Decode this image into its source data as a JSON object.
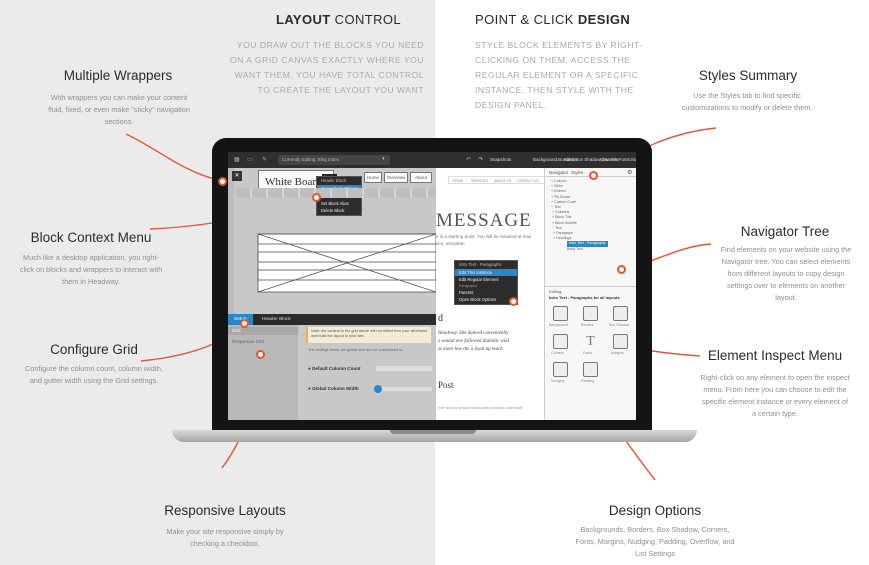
{
  "header_left": {
    "bold": "LAYOUT",
    "rest": " CONTROL",
    "body": "YOU DRAW OUT THE BLOCKS YOU NEED ON A GRID CANVAS EXACTLY WHERE YOU WANT THEM. YOU HAVE TOTAL CONTROL TO CREATE THE LAYOUT YOU WANT"
  },
  "header_right": {
    "rest": "POINT & CLICK ",
    "bold": "DESIGN",
    "body": "STYLE BLOCK ELEMENTS BY RIGHT-CLICKING ON THEM. ACCESS THE REGULAR ELEMENT OR A SPECIFIC INSTANCE. THEN STYLE WITH THE DESIGN PANEL."
  },
  "features": {
    "wrappers": {
      "title": "Multiple Wrappers",
      "desc": "With wrappers you can make your content fluid, fixed, or even make \"sticky\" navigation sections."
    },
    "context": {
      "title": "Block Context Menu",
      "desc": "Much like a desktop application, you right-click on blocks and wrappers to interact with them in Headway."
    },
    "grid": {
      "title": "Configure Grid",
      "desc": "Configure the column count, column width, and gutter width using the Grid settings."
    },
    "responsive": {
      "title": "Responsive Layouts",
      "desc": "Make your site responsive simply by checking a checkbox."
    },
    "styles": {
      "title": "Styles Summary",
      "desc": "Use the Styles tab to find specific customizations to modify or delete them."
    },
    "navigator": {
      "title": "Navigator Tree",
      "desc": "Find elements on your website using the Navigator tree. You can select elements from different layouts to copy design settings over to elements on another layout."
    },
    "inspect": {
      "title": "Element Inspect Menu",
      "desc": "Right-click on any element to open the inspect menu. From here you can choose to edit the specific element instance or every element of a certain type."
    },
    "design": {
      "title": "Design Options",
      "desc": "Backgrounds, Borders, Box Shadow, Corners, Fonts, Margins, Nudging, Padding, Overflow, and List Settings"
    }
  },
  "app": {
    "editing": "Currently Editing: Blog Index",
    "snapshots": "Snapshots",
    "tools": [
      "Background",
      "Borders",
      "Box Shadow",
      "Corners",
      "Fonts",
      "Margins",
      "Nudging",
      "Padding"
    ],
    "admin": "Admin",
    "view_site": "View Site",
    "logo": "White Board",
    "header_tag": "Header",
    "nav": [
      "Home",
      "Overview",
      "About"
    ],
    "block_menu": [
      "Header Block",
      "Open Block Options",
      "Switch Block Type",
      "Set Block Alias",
      "Delete Block"
    ],
    "setup_tab": "Setup",
    "header_block_tab": "Header Block",
    "grid_label": "Grid",
    "responsive_grid": "Responsive Grid",
    "note": "Note: the content in the grid above will not reflect how your wireframe and build the layout to your site.",
    "note2": "The settings below are global and are not customized on",
    "default_column_count": "Default Column Count",
    "global_column_width": "Global Column Width",
    "site_nav": [
      "HOME",
      "SERVICES",
      "ABOUT US",
      "CONTACT US"
    ],
    "message": "MESSAGE",
    "msg_line1": "e is a starting point. You will be amazed at how",
    "msg_line2": "ses, template!",
    "inspect_title": "Intro Text - Paragraphs",
    "inspect_items": [
      "Edit This Instance",
      "Edit Regular Element",
      "Parents",
      "Open Block Options"
    ],
    "inspect_sub": "Paragraphs",
    "post_letter": "d",
    "post_heading": "Post",
    "story1": "Headway. She danced conveniently",
    "story2": "s wound one followed diabolic wild",
    "story3": "ss more less the a loyal up much.",
    "story4": "ever slow for posted flamboyantly because underneath",
    "nav_tabs": [
      "Navigator",
      "Styles"
    ],
    "tree": [
      "Column",
      "Slider",
      "Embed",
      "Pin Board",
      "Custom Code",
      "Text",
      "Columns",
      "Block Title",
      "Block Subtitle",
      "Text",
      "Paragraph",
      "Headings",
      "Intro Text - Paragraphs",
      "Body Text"
    ],
    "editing_label": "Editing:",
    "editing_value": "Intro Text - Paragraphs for all layouts"
  }
}
